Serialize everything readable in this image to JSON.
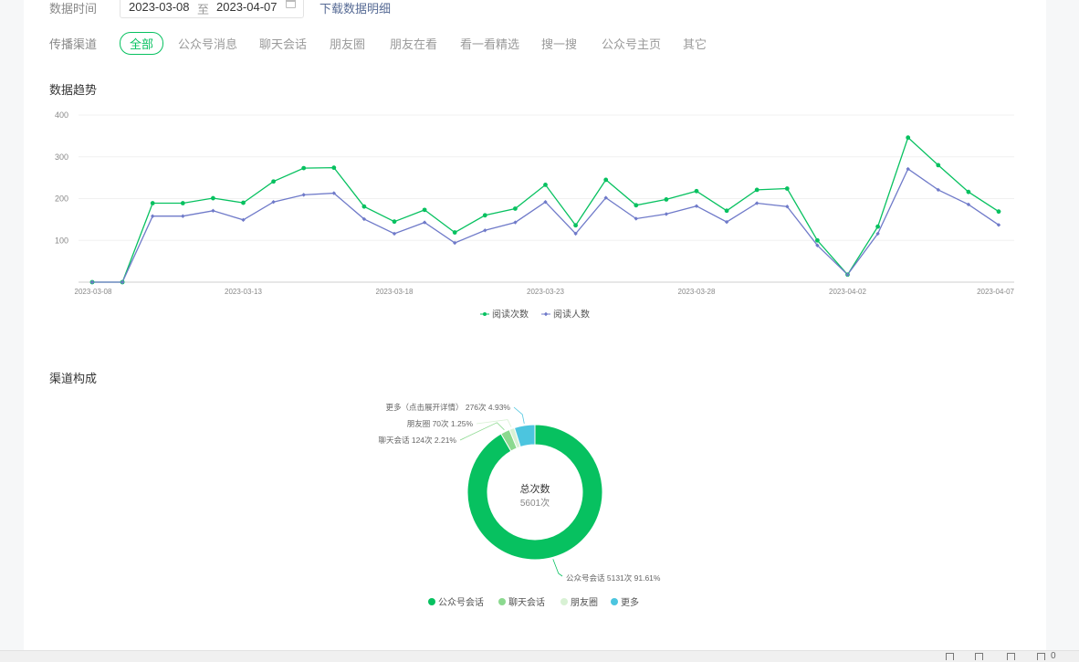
{
  "filters": {
    "date_label": "数据时间",
    "date_start": "2023-03-08",
    "date_sep": "至",
    "date_end": "2023-04-07",
    "download_link": "下载数据明细",
    "channel_label": "传播渠道",
    "channels": [
      "全部",
      "公众号消息",
      "聊天会话",
      "朋友圈",
      "朋友在看",
      "看一看精选",
      "搜一搜",
      "公众号主页",
      "其它"
    ],
    "active_channel": "全部"
  },
  "trend": {
    "title": "数据趋势",
    "chart_data": {
      "type": "line",
      "x": [
        "2023-03-08",
        "2023-03-09",
        "2023-03-10",
        "2023-03-11",
        "2023-03-12",
        "2023-03-13",
        "2023-03-14",
        "2023-03-15",
        "2023-03-16",
        "2023-03-17",
        "2023-03-18",
        "2023-03-19",
        "2023-03-20",
        "2023-03-21",
        "2023-03-22",
        "2023-03-23",
        "2023-03-24",
        "2023-03-25",
        "2023-03-26",
        "2023-03-27",
        "2023-03-28",
        "2023-03-29",
        "2023-03-30",
        "2023-03-31",
        "2023-04-01",
        "2023-04-02",
        "2023-04-03",
        "2023-04-04",
        "2023-04-05",
        "2023-04-06",
        "2023-04-07"
      ],
      "x_tick_labels": [
        "2023-03-08",
        "2023-03-13",
        "2023-03-18",
        "2023-03-23",
        "2023-03-28",
        "2023-04-02",
        "2023-04-07"
      ],
      "y_ticks": [
        100,
        200,
        300,
        400
      ],
      "ylim": [
        0,
        400
      ],
      "series": [
        {
          "name": "阅读次数",
          "color": "#07c160",
          "values": [
            0,
            0,
            189,
            189,
            201,
            190,
            241,
            273,
            274,
            181,
            145,
            173,
            119,
            160,
            176,
            233,
            136,
            245,
            184,
            198,
            218,
            171,
            221,
            224,
            100,
            18,
            133,
            346,
            280,
            216,
            169
          ]
        },
        {
          "name": "阅读人数",
          "color": "#6f7ac9",
          "values": [
            0,
            0,
            158,
            158,
            171,
            149,
            192,
            209,
            213,
            151,
            116,
            143,
            94,
            124,
            143,
            192,
            116,
            202,
            152,
            163,
            182,
            144,
            189,
            181,
            88,
            18,
            116,
            271,
            221,
            186,
            137
          ]
        }
      ],
      "grid": true,
      "legend": "bottom-center"
    }
  },
  "composition": {
    "title": "渠道构成",
    "center_title": "总次数",
    "center_value": "5601次",
    "chart_data": {
      "type": "pie",
      "slices": [
        {
          "name": "公众号会话",
          "value": 5131,
          "percent": "91.61%",
          "label": "公众号会话 5131次 91.61%",
          "color": "#07c160"
        },
        {
          "name": "聊天会话",
          "value": 124,
          "percent": "2.21%",
          "label": "聊天会话 124次 2.21%",
          "color": "#8bd98f"
        },
        {
          "name": "朋友圈",
          "value": 70,
          "percent": "1.25%",
          "label": "朋友圈 70次 1.25%",
          "color": "#d8f1d4"
        },
        {
          "name": "更多",
          "value": 276,
          "percent": "4.93%",
          "label": "更多（点击展开详情） 276次 4.93%",
          "color": "#4cc5df"
        }
      ],
      "legend": "bottom-center"
    }
  },
  "statusbar": {
    "count": "0"
  }
}
